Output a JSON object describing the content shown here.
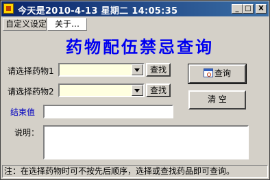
{
  "window": {
    "title": "今天是2010-4-13  星期二  14:05:35",
    "controls": {
      "minimize": "_",
      "maximize": "□",
      "close": "X"
    }
  },
  "menu": {
    "items": [
      "自定义设定",
      "关于…"
    ]
  },
  "main": {
    "heading": "药物配伍禁忌查询",
    "drug1": {
      "label": "请选择药物1",
      "value": "",
      "find_label": "查找"
    },
    "drug2": {
      "label": "请选择药物2",
      "value": "",
      "find_label": "查找"
    },
    "result": {
      "label": "结束值",
      "value": "",
      "label_color": "#0000c0"
    },
    "note": {
      "label": "说明：",
      "value": ""
    },
    "query_button": "查询",
    "clear_button": "清 空"
  },
  "status": {
    "text": "注：在选择药物时可不按先后顺序，选择或查找药品即可查询。"
  },
  "icons": {
    "app": "app-icon",
    "query": "calendar-query-icon"
  },
  "colors": {
    "title_gradient_start": "#0a246a",
    "title_gradient_end": "#3a6ea5",
    "heading": "#0000f0",
    "combo_bg": "#ffffe0"
  }
}
